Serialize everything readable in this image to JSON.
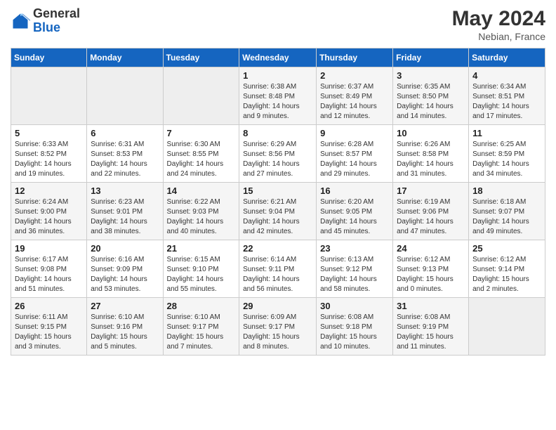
{
  "header": {
    "logo_general": "General",
    "logo_blue": "Blue",
    "month_year": "May 2024",
    "location": "Nebian, France"
  },
  "days_of_week": [
    "Sunday",
    "Monday",
    "Tuesday",
    "Wednesday",
    "Thursday",
    "Friday",
    "Saturday"
  ],
  "weeks": [
    [
      {
        "day": "",
        "info": ""
      },
      {
        "day": "",
        "info": ""
      },
      {
        "day": "",
        "info": ""
      },
      {
        "day": "1",
        "info": "Sunrise: 6:38 AM\nSunset: 8:48 PM\nDaylight: 14 hours\nand 9 minutes."
      },
      {
        "day": "2",
        "info": "Sunrise: 6:37 AM\nSunset: 8:49 PM\nDaylight: 14 hours\nand 12 minutes."
      },
      {
        "day": "3",
        "info": "Sunrise: 6:35 AM\nSunset: 8:50 PM\nDaylight: 14 hours\nand 14 minutes."
      },
      {
        "day": "4",
        "info": "Sunrise: 6:34 AM\nSunset: 8:51 PM\nDaylight: 14 hours\nand 17 minutes."
      }
    ],
    [
      {
        "day": "5",
        "info": "Sunrise: 6:33 AM\nSunset: 8:52 PM\nDaylight: 14 hours\nand 19 minutes."
      },
      {
        "day": "6",
        "info": "Sunrise: 6:31 AM\nSunset: 8:53 PM\nDaylight: 14 hours\nand 22 minutes."
      },
      {
        "day": "7",
        "info": "Sunrise: 6:30 AM\nSunset: 8:55 PM\nDaylight: 14 hours\nand 24 minutes."
      },
      {
        "day": "8",
        "info": "Sunrise: 6:29 AM\nSunset: 8:56 PM\nDaylight: 14 hours\nand 27 minutes."
      },
      {
        "day": "9",
        "info": "Sunrise: 6:28 AM\nSunset: 8:57 PM\nDaylight: 14 hours\nand 29 minutes."
      },
      {
        "day": "10",
        "info": "Sunrise: 6:26 AM\nSunset: 8:58 PM\nDaylight: 14 hours\nand 31 minutes."
      },
      {
        "day": "11",
        "info": "Sunrise: 6:25 AM\nSunset: 8:59 PM\nDaylight: 14 hours\nand 34 minutes."
      }
    ],
    [
      {
        "day": "12",
        "info": "Sunrise: 6:24 AM\nSunset: 9:00 PM\nDaylight: 14 hours\nand 36 minutes."
      },
      {
        "day": "13",
        "info": "Sunrise: 6:23 AM\nSunset: 9:01 PM\nDaylight: 14 hours\nand 38 minutes."
      },
      {
        "day": "14",
        "info": "Sunrise: 6:22 AM\nSunset: 9:03 PM\nDaylight: 14 hours\nand 40 minutes."
      },
      {
        "day": "15",
        "info": "Sunrise: 6:21 AM\nSunset: 9:04 PM\nDaylight: 14 hours\nand 42 minutes."
      },
      {
        "day": "16",
        "info": "Sunrise: 6:20 AM\nSunset: 9:05 PM\nDaylight: 14 hours\nand 45 minutes."
      },
      {
        "day": "17",
        "info": "Sunrise: 6:19 AM\nSunset: 9:06 PM\nDaylight: 14 hours\nand 47 minutes."
      },
      {
        "day": "18",
        "info": "Sunrise: 6:18 AM\nSunset: 9:07 PM\nDaylight: 14 hours\nand 49 minutes."
      }
    ],
    [
      {
        "day": "19",
        "info": "Sunrise: 6:17 AM\nSunset: 9:08 PM\nDaylight: 14 hours\nand 51 minutes."
      },
      {
        "day": "20",
        "info": "Sunrise: 6:16 AM\nSunset: 9:09 PM\nDaylight: 14 hours\nand 53 minutes."
      },
      {
        "day": "21",
        "info": "Sunrise: 6:15 AM\nSunset: 9:10 PM\nDaylight: 14 hours\nand 55 minutes."
      },
      {
        "day": "22",
        "info": "Sunrise: 6:14 AM\nSunset: 9:11 PM\nDaylight: 14 hours\nand 56 minutes."
      },
      {
        "day": "23",
        "info": "Sunrise: 6:13 AM\nSunset: 9:12 PM\nDaylight: 14 hours\nand 58 minutes."
      },
      {
        "day": "24",
        "info": "Sunrise: 6:12 AM\nSunset: 9:13 PM\nDaylight: 15 hours\nand 0 minutes."
      },
      {
        "day": "25",
        "info": "Sunrise: 6:12 AM\nSunset: 9:14 PM\nDaylight: 15 hours\nand 2 minutes."
      }
    ],
    [
      {
        "day": "26",
        "info": "Sunrise: 6:11 AM\nSunset: 9:15 PM\nDaylight: 15 hours\nand 3 minutes."
      },
      {
        "day": "27",
        "info": "Sunrise: 6:10 AM\nSunset: 9:16 PM\nDaylight: 15 hours\nand 5 minutes."
      },
      {
        "day": "28",
        "info": "Sunrise: 6:10 AM\nSunset: 9:17 PM\nDaylight: 15 hours\nand 7 minutes."
      },
      {
        "day": "29",
        "info": "Sunrise: 6:09 AM\nSunset: 9:17 PM\nDaylight: 15 hours\nand 8 minutes."
      },
      {
        "day": "30",
        "info": "Sunrise: 6:08 AM\nSunset: 9:18 PM\nDaylight: 15 hours\nand 10 minutes."
      },
      {
        "day": "31",
        "info": "Sunrise: 6:08 AM\nSunset: 9:19 PM\nDaylight: 15 hours\nand 11 minutes."
      },
      {
        "day": "",
        "info": ""
      }
    ]
  ]
}
